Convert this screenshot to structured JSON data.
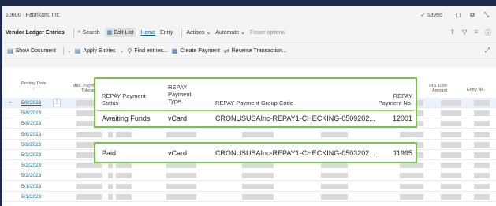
{
  "breadcrumb": "10000 · Fabrikam, Inc.",
  "saved_label": "Saved",
  "page_title": "Vendor Ledger Entries",
  "actions": {
    "search": "Search",
    "edit_list": "Edit List",
    "home": "Home",
    "entry": "Entry",
    "actions_menu": "Actions",
    "automate": "Automate",
    "fewer_options": "Fewer options"
  },
  "commands": {
    "show_document": "Show Document",
    "apply_entries": "Apply Entries",
    "find_entries": "Find entries...",
    "create_payment": "Create Payment",
    "reverse_transaction": "Reverse Transaction..."
  },
  "columns": {
    "posting_date": "Posting Date",
    "max_payment_tolerance_a": "Max. Payment",
    "max_payment_tolerance_b": "Tolerance",
    "irs_1099_a": "IRS 1099",
    "irs_1099_b": "Amount",
    "entry_no": "Entry No."
  },
  "rows": [
    {
      "date": "5/8/2023"
    },
    {
      "date": "5/8/2023"
    },
    {
      "date": "5/8/2023"
    },
    {
      "date": "5/8/2023"
    },
    {
      "date": "5/2/2023"
    },
    {
      "date": "5/2/2023"
    },
    {
      "date": "5/2/2023"
    },
    {
      "date": "5/2/2023"
    },
    {
      "date": "5/1/2023"
    },
    {
      "date": "5/1/2023"
    }
  ],
  "callout": {
    "headers": {
      "status_a": "REPAY Payment",
      "status_b": "Status",
      "type_a": "REPAY",
      "type_b": "Payment",
      "type_c": "Type",
      "group": "REPAY Payment Group Code",
      "payno_a": "REPAY",
      "payno_b": "Payment No."
    },
    "row1": {
      "status": "Awaiting Funds",
      "type": "vCard",
      "group": "CRONUSUSAInc-REPAY1-CHECKING-0509202...",
      "payment_no": "12001"
    },
    "row2": {
      "status": "Paid",
      "type": "vCard",
      "group": "CRONUSUSAInc-REPAY1-CHECKING-0503202...",
      "payment_no": "11995"
    }
  },
  "colors": {
    "frame": "#1e2a4a",
    "highlight": "#7cc04a",
    "link": "#0f6b8f"
  }
}
